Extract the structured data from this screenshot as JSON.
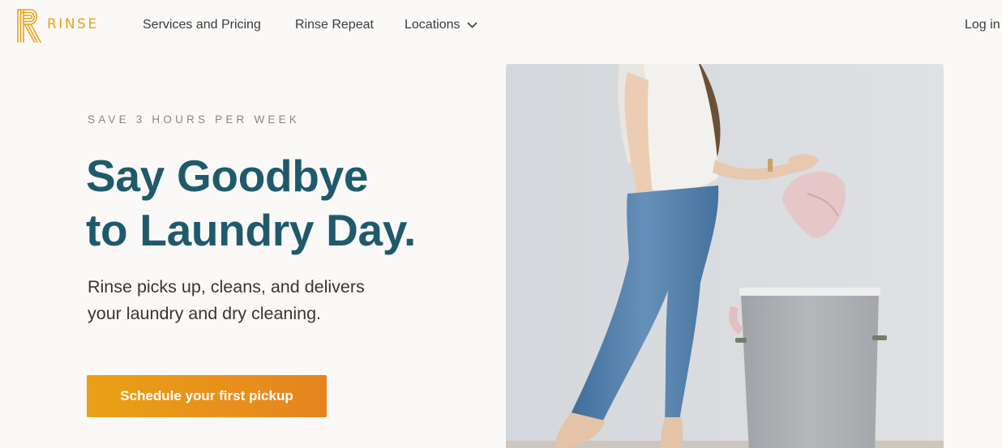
{
  "brand": {
    "name": "RINSE",
    "color": "#e8a31c"
  },
  "nav": {
    "services": "Services and Pricing",
    "repeat": "Rinse Repeat",
    "locations": "Locations",
    "login": "Log in"
  },
  "hero": {
    "eyebrow": "SAVE 3 HOURS PER WEEK",
    "headline_line1": "Say Goodbye",
    "headline_line2": "to Laundry Day.",
    "subhead_line1": "Rinse picks up, cleans, and delivers",
    "subhead_line2": "your laundry and dry cleaning.",
    "cta": "Schedule your first pickup",
    "image_icon": "woman-with-laundry-hamper-photo"
  },
  "colors": {
    "headline": "#1f5a6b",
    "cta_start": "#eaa115",
    "cta_end": "#e6841f",
    "background": "#faf9f8"
  }
}
